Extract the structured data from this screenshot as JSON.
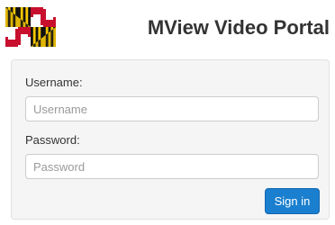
{
  "header": {
    "logo_icon": "maryland-flag-icon",
    "title": "MView Video Portal"
  },
  "login_form": {
    "username_label": "Username:",
    "username_placeholder": "Username",
    "username_value": "",
    "password_label": "Password:",
    "password_placeholder": "Password",
    "password_value": "",
    "submit_label": "Sign in"
  },
  "colors": {
    "button": "#1a7fcf",
    "panel": "#f5f5f5",
    "title": "#333333"
  }
}
